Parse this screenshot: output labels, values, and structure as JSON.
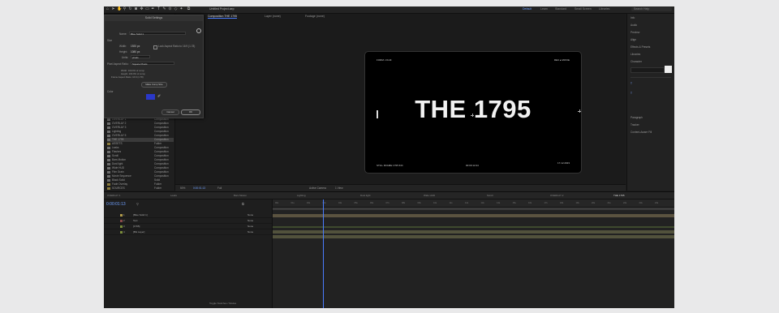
{
  "toolbar": {
    "file_name": "Untitled Project.aep",
    "workspaces": [
      "Default",
      "Learn",
      "Standard",
      "Small Screen",
      "Libraries"
    ],
    "active_workspace": "Default",
    "search_placeholder": "Search Help"
  },
  "composition_tabs": [
    "Composition THE 1795",
    "Layer (none)",
    "Footage (none)"
  ],
  "viewer": {
    "title": "THE 1795",
    "top_left": "FORM • FILM",
    "top_right": "REC ▸ MOVIE",
    "bottom_left": "STILL FRAME 1795 INC",
    "bottom_center": "00:00:12:24",
    "bottom_right": "17.12.2023"
  },
  "viewer_bar": {
    "zoom": "50%",
    "resolution": "Full",
    "camera": "Active Camera",
    "views": "1 View",
    "timecode": "0:00:01:13"
  },
  "dialog": {
    "title": "Solid Settings",
    "name_label": "Name:",
    "name_value": "Blue Solid 1",
    "size_label": "Size",
    "width_label": "Width:",
    "width_value": "1920 px",
    "height_label": "Height:",
    "height_value": "1080 px",
    "lock_label": "Lock Aspect Ratio to 16:9 (1.78)",
    "units_label": "Units:",
    "units_value": "pixels",
    "par_label": "Pixel Aspect Ratio:",
    "par_value": "Square Pixels",
    "info_width": "Width: 100.0% of comp",
    "info_height": "Height: 100.0% of comp",
    "info_frame": "Frame Aspect Ratio: 16:9 (1.78)",
    "make_comp_size": "Make Comp Size",
    "color_label": "Color",
    "swatch_color": "#2a38c9",
    "cancel": "Cancel",
    "ok": "OK"
  },
  "project_items": [
    {
      "name": "OVERLAY 1",
      "type": "Composition"
    },
    {
      "name": "OVERLAY 2",
      "type": "Composition"
    },
    {
      "name": "OVERLAY 3",
      "type": "Composition"
    },
    {
      "name": "Lighting",
      "type": "Composition"
    },
    {
      "name": "OVERLAY 5",
      "type": "Composition"
    },
    {
      "name": "THE 1795",
      "type": "Composition"
    },
    {
      "name": "ASSETS",
      "type": "Folder"
    },
    {
      "name": "Leaks",
      "type": "Composition"
    },
    {
      "name": "Flashes",
      "type": "Composition"
    },
    {
      "name": "Scroll",
      "type": "Composition"
    },
    {
      "name": "Bars Motion",
      "type": "Composition"
    },
    {
      "name": "Dust light",
      "type": "Composition"
    },
    {
      "name": "Wide HUD",
      "type": "Composition"
    },
    {
      "name": "Film Grain",
      "type": "Composition"
    },
    {
      "name": "Movie Sequence",
      "type": "Composition"
    },
    {
      "name": "Black Solid",
      "type": "Solid"
    },
    {
      "name": "Fade Overlay",
      "type": "Folder"
    },
    {
      "name": "SOURCES",
      "type": "Folder"
    }
  ],
  "right_panel": [
    "Info",
    "Audio",
    "Preview",
    "Align",
    "Effects & Presets",
    "Libraries",
    "Character",
    "Paragraph",
    "Tracker",
    "Content-Aware Fill"
  ],
  "timeline": {
    "tabs": [
      "OVERLAY 1",
      "Leaks",
      "Bars Motion",
      "Lighting",
      "Dust light",
      "Wide HUD",
      "Scroll",
      "OVERLAY 2",
      "THE 1795"
    ],
    "active_tab": "THE 1795",
    "timecode": "0:00:01:13",
    "ruler_ticks": [
      "00s",
      "01s",
      "02s",
      "03s",
      "04s",
      "05s",
      "06s",
      "07s",
      "08s",
      "09s",
      "10s",
      "11s",
      "12s",
      "13s",
      "14s",
      "15s",
      "16s",
      "17s",
      "18s",
      "19s",
      "20s",
      "21s",
      "22s",
      "23s",
      "24s"
    ],
    "layers": [
      {
        "num": "1",
        "name": "[Blue Solid 1]",
        "mode": "None",
        "color": "#b09a4a"
      },
      {
        "num": "2",
        "name": "Text",
        "mode": "None",
        "color": "#8a4a4a"
      },
      {
        "num": "3",
        "name": "[1795]",
        "mode": "None",
        "color": "#7a8c3a"
      },
      {
        "num": "4",
        "name": "[BG Layer]",
        "mode": "None",
        "color": "#7a8c3a"
      }
    ],
    "footer": "Toggle Switches / Modes"
  }
}
